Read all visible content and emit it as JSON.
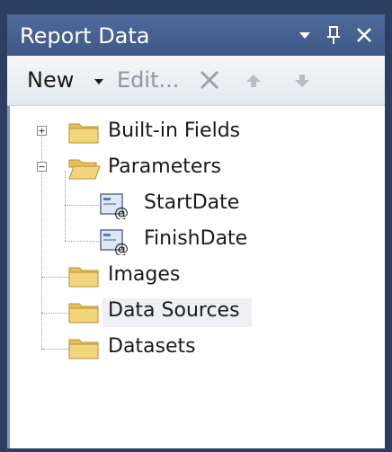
{
  "window": {
    "title": "Report Data"
  },
  "titlebar_icons": {
    "menu": "dropdown-arrow-icon",
    "pin": "pin-icon",
    "close": "close-icon"
  },
  "toolbar": {
    "new_label": "New",
    "edit_label": "Edit...",
    "delete_icon": "delete-x-icon",
    "move_up_icon": "move-up-icon",
    "move_down_icon": "move-down-icon"
  },
  "tree": {
    "items": [
      {
        "label": "Built-in Fields",
        "type": "folder",
        "expander": "+"
      },
      {
        "label": "Parameters",
        "type": "folder-open",
        "expander": "-"
      },
      {
        "label": "StartDate",
        "type": "parameter"
      },
      {
        "label": "FinishDate",
        "type": "parameter"
      },
      {
        "label": "Images",
        "type": "folder"
      },
      {
        "label": "Data Sources",
        "type": "folder"
      },
      {
        "label": "Datasets",
        "type": "folder"
      }
    ]
  },
  "colors": {
    "titlebar": "#3e5886",
    "frame": "#2d3f60",
    "folder": "#e8c15a",
    "watermark": "#2f9a3a"
  }
}
